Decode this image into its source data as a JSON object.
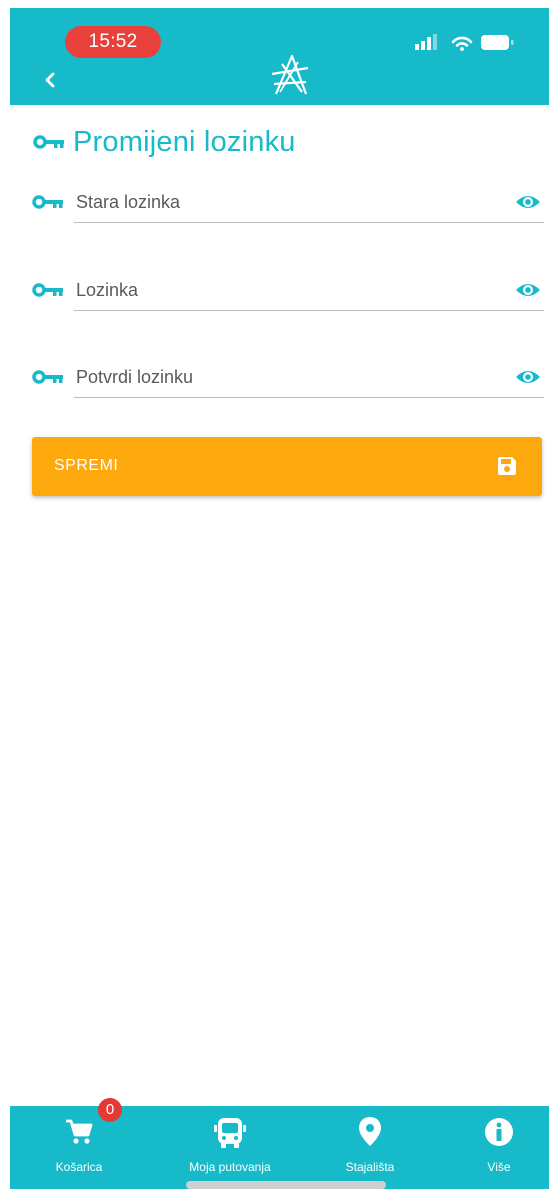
{
  "status_bar": {
    "time": "15:52"
  },
  "header": {
    "back_icon": "chevron-left-icon",
    "logo_icon": "app-logo-icon"
  },
  "page": {
    "title": "Promijeni lozinku",
    "title_icon": "key-icon"
  },
  "form": {
    "fields": [
      {
        "placeholder": "Stara lozinka",
        "value": ""
      },
      {
        "placeholder": "Lozinka",
        "value": ""
      },
      {
        "placeholder": "Potvrdi lozinku",
        "value": ""
      }
    ],
    "save_label": "SPREMI"
  },
  "bottom_nav": {
    "items": [
      {
        "label": "Košarica",
        "icon": "cart-icon",
        "badge": "0"
      },
      {
        "label": "Moja putovanja",
        "icon": "bus-icon"
      },
      {
        "label": "Stajališta",
        "icon": "location-pin-icon"
      },
      {
        "label": "Više",
        "icon": "info-icon"
      }
    ]
  },
  "colors": {
    "primary": "#17bac9",
    "accent": "#fda80d",
    "badge": "#e53935",
    "status_pill": "#e8413b"
  }
}
